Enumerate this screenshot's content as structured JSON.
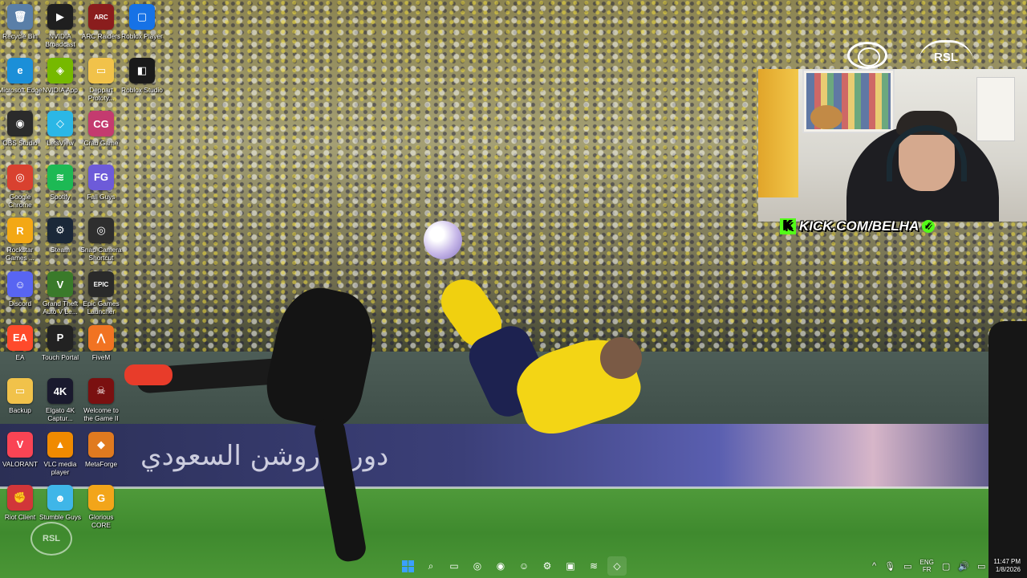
{
  "desktop": {
    "icons": [
      {
        "label": "Recycle Bin",
        "icon": "recycle-bin-icon",
        "glyph": "🗑",
        "color": "#5a7fa8"
      },
      {
        "label": "Microsoft Edge",
        "icon": "edge-icon",
        "glyph": "e",
        "color": "#1b8fd8"
      },
      {
        "label": "OBS Studio",
        "icon": "obs-icon",
        "glyph": "◉",
        "color": "#2b2b2b"
      },
      {
        "label": "Google Chrome",
        "icon": "chrome-icon",
        "glyph": "◎",
        "color": "#d9412f"
      },
      {
        "label": "Rockstar Games ...",
        "icon": "rockstar-icon",
        "glyph": "R",
        "color": "#f3a815"
      },
      {
        "label": "Discord",
        "icon": "discord-icon",
        "glyph": "☺",
        "color": "#5865f2"
      },
      {
        "label": "EA",
        "icon": "ea-icon",
        "glyph": "EA",
        "color": "#ff4a2b"
      },
      {
        "label": "Backup",
        "icon": "folder-icon",
        "glyph": "▭",
        "color": "#f1c24a"
      },
      {
        "label": "VALORANT",
        "icon": "valorant-icon",
        "glyph": "V",
        "color": "#fa4454"
      },
      {
        "label": "Riot Client",
        "icon": "riot-icon",
        "glyph": "✊",
        "color": "#d13639"
      },
      {
        "label": "NVIDIA Broadcast",
        "icon": "nvidia-broadcast-icon",
        "glyph": "▶",
        "color": "#1f1f1f"
      },
      {
        "label": "NVIDIA App",
        "icon": "nvidia-icon",
        "glyph": "◈",
        "color": "#76b900"
      },
      {
        "label": "LetsView",
        "icon": "letsview-icon",
        "glyph": "◇",
        "color": "#2bb7e6"
      },
      {
        "label": "Spotify",
        "icon": "spotify-icon",
        "glyph": "≋",
        "color": "#1db954"
      },
      {
        "label": "Steam",
        "icon": "steam-icon",
        "glyph": "⚙",
        "color": "#1b2838"
      },
      {
        "label": "Grand Theft Auto V Le...",
        "icon": "gta-icon",
        "glyph": "V",
        "color": "#3a7a2a"
      },
      {
        "label": "Touch Portal",
        "icon": "touch-portal-icon",
        "glyph": "P",
        "color": "#222"
      },
      {
        "label": "Elgato 4K Captur...",
        "icon": "elgato-icon",
        "glyph": "4K",
        "color": "#1a1a2e"
      },
      {
        "label": "VLC media player",
        "icon": "vlc-icon",
        "glyph": "▲",
        "color": "#f08a00"
      },
      {
        "label": "Stumble Guys",
        "icon": "stumble-guys-icon",
        "glyph": "☻",
        "color": "#3fb6e8"
      },
      {
        "label": "ARC Raiders",
        "icon": "arc-raiders-icon",
        "glyph": "ARC",
        "color": "#8a1d1d"
      },
      {
        "label": "Deppart Prototy...",
        "icon": "folder-icon",
        "glyph": "▭",
        "color": "#f1c24a"
      },
      {
        "label": "Crab Game",
        "icon": "crab-game-icon",
        "glyph": "CG",
        "color": "#c43b6f"
      },
      {
        "label": "Fall Guys",
        "icon": "fall-guys-icon",
        "glyph": "FG",
        "color": "#6d5bd9"
      },
      {
        "label": "Snap Camera Shortcut",
        "icon": "snap-camera-icon",
        "glyph": "◎",
        "color": "#2e2e2e"
      },
      {
        "label": "Epic Games Launcher",
        "icon": "epic-games-icon",
        "glyph": "EPIC",
        "color": "#2a2a2a"
      },
      {
        "label": "FiveM",
        "icon": "fivem-icon",
        "glyph": "⋀",
        "color": "#f17322"
      },
      {
        "label": "Welcome to the Game II",
        "icon": "welcome-game-icon",
        "glyph": "☠",
        "color": "#7a1010"
      },
      {
        "label": "MetaForge",
        "icon": "metaforge-icon",
        "glyph": "◆",
        "color": "#e07a1f"
      },
      {
        "label": "Glorious CORE",
        "icon": "glorious-core-icon",
        "glyph": "G",
        "color": "#f2a51a"
      },
      {
        "label": "Roblox Player",
        "icon": "roblox-player-icon",
        "glyph": "▢",
        "color": "#1672e6"
      },
      {
        "label": "Roblox Studio",
        "icon": "roblox-studio-icon",
        "glyph": "◧",
        "color": "#1a1a1a"
      }
    ]
  },
  "stream": {
    "kick_handle": "KICK.COM/BELHA",
    "kick_k": "K",
    "verified": "✓",
    "broadcaster_logo": "RSL",
    "watermark": "RSL",
    "ad_text": "دوري روشن السعودي"
  },
  "taskbar": {
    "apps": [
      {
        "icon": "windows-start-icon"
      },
      {
        "icon": "search-icon",
        "glyph": "⌕"
      },
      {
        "icon": "file-explorer-icon",
        "glyph": "▭"
      },
      {
        "icon": "chrome-icon",
        "glyph": "◎"
      },
      {
        "icon": "obs-icon",
        "glyph": "◉"
      },
      {
        "icon": "discord-icon",
        "glyph": "☺"
      },
      {
        "icon": "steam-icon",
        "glyph": "⚙"
      },
      {
        "icon": "terminal-icon",
        "glyph": "▣"
      },
      {
        "icon": "spotify-icon",
        "glyph": "≋"
      },
      {
        "icon": "letsview-icon",
        "glyph": "◇"
      }
    ],
    "tray": {
      "chevron": "^",
      "language_top": "ENG",
      "language_bottom": "FR",
      "time": "11:47 PM",
      "date": "1/8/2026"
    }
  },
  "colors": {
    "accent_kick": "#53fc18",
    "taskbar_start": "#3aa0ff"
  }
}
